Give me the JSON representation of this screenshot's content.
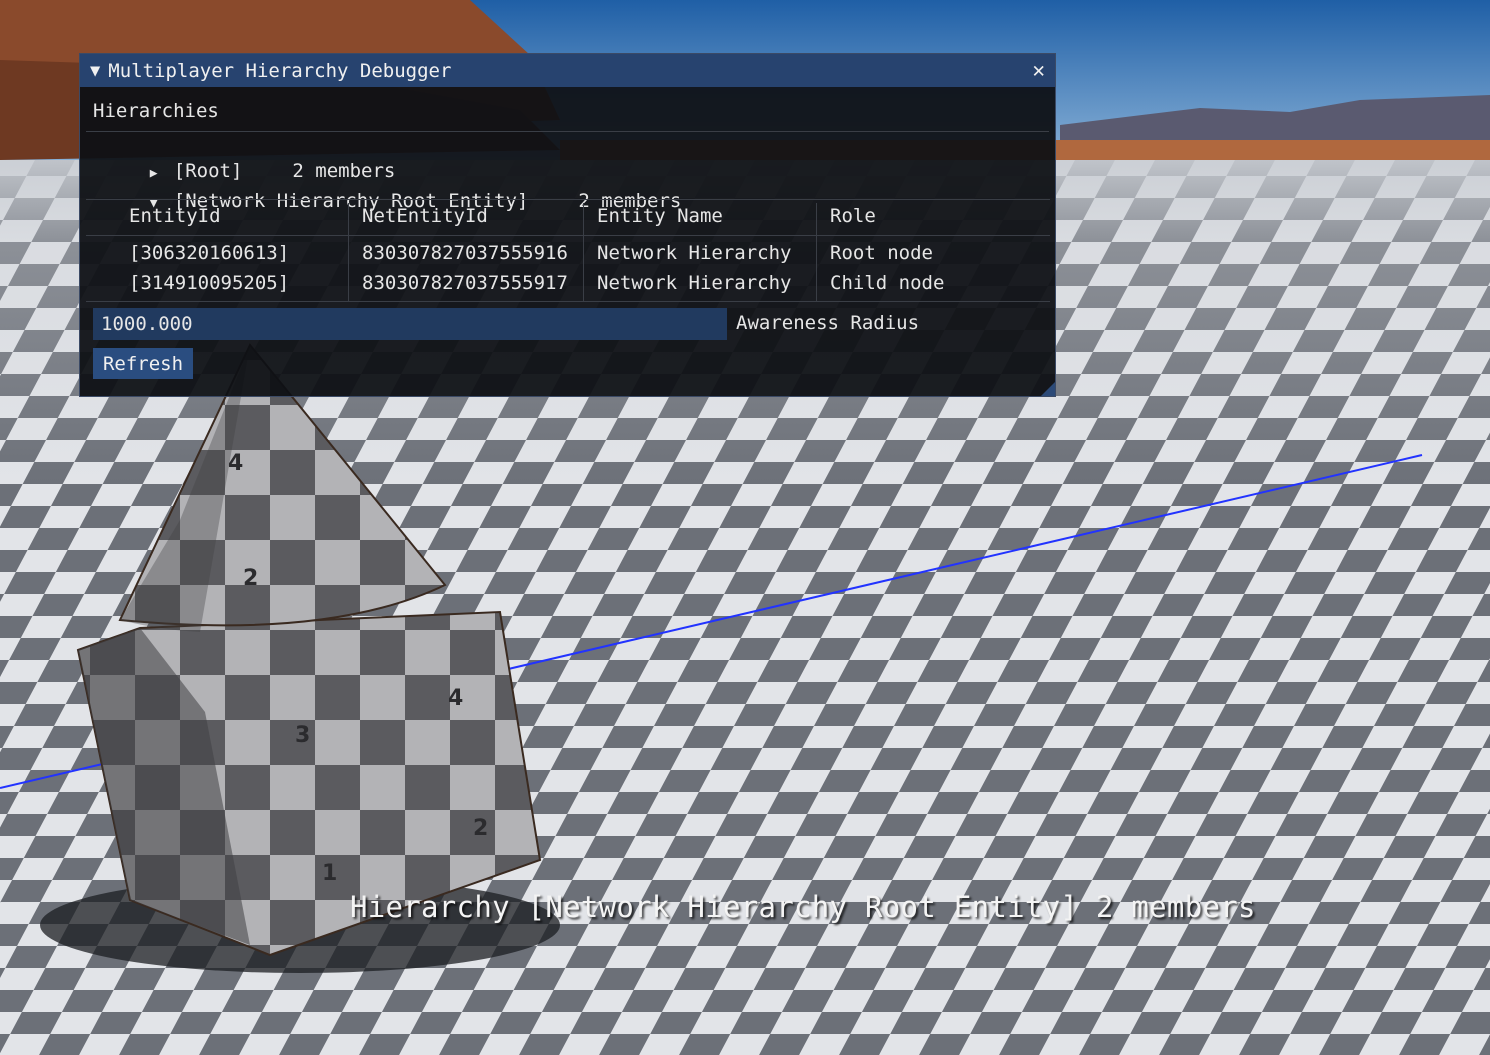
{
  "window": {
    "title": "Multiplayer Hierarchy Debugger",
    "collapse_icon": "triangle-down-icon",
    "close_icon": "close-icon"
  },
  "section": {
    "header": "Hierarchies"
  },
  "tree": [
    {
      "label": "[Root]",
      "members": "2 members",
      "expanded": false
    },
    {
      "label": "[Network Hierarchy Root Entity]",
      "members": "2 members",
      "expanded": true
    }
  ],
  "table": {
    "headers": [
      "EntityId",
      "NetEntityId",
      "Entity Name",
      "Role"
    ],
    "rows": [
      [
        "[306320160613]",
        "830307827037555916",
        "Network Hierarchy",
        "Root node"
      ],
      [
        "[314910095205]",
        "830307827037555917",
        "Network Hierarchy",
        "Child node"
      ]
    ]
  },
  "awareness": {
    "value": "1000.000",
    "label": "Awareness Radius"
  },
  "refresh_label": "Refresh",
  "overlay_text": "Hierarchy [Network Hierarchy Root Entity] 2 members",
  "colors": {
    "title_bar": "#27436f",
    "window_bg": "#0e1014",
    "input_bg": "#213a5f",
    "button_bg": "#2a4d80",
    "axis_line": "#2233ff"
  }
}
